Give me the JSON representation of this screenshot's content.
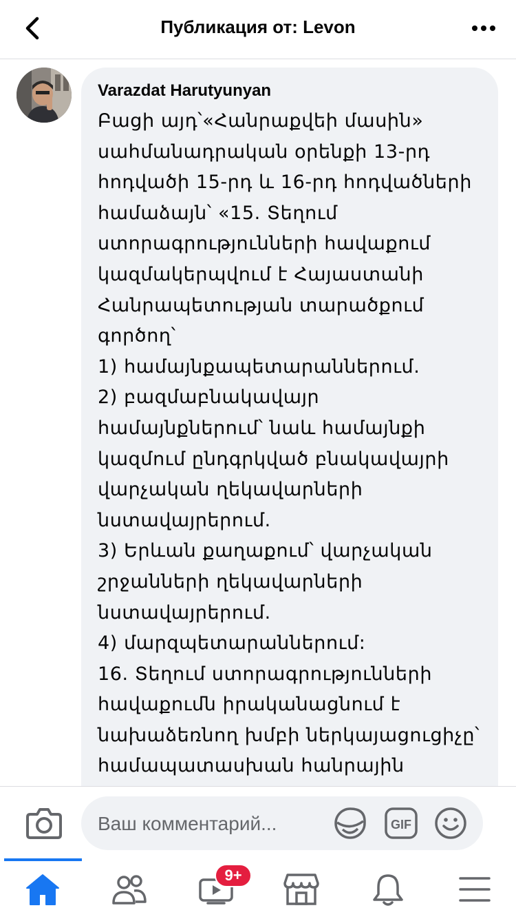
{
  "header": {
    "title": "Публикация от: Levon",
    "back_icon": "chevron-left-icon",
    "more_icon": "more-horizontal-icon"
  },
  "comment": {
    "author": "Varazdat Harutyunyan",
    "text": "Բացի այդ՝«Հանրաքվեի մասին» սահմանադրական օրենքի 13-րդ հոդվածի 15-րդ և 16-րդ հոդվածների համաձայն՝ «15. Տեղում ստորագրությունների հավաքում կազմակերպվում է Հայաստանի Հանրապետության տարածքում գործող՝\n1) համայնքապետարաններում.\n2) բազմաբնակավայր համայնքներում՝ նաև համայնքի կազմում ընդգրկված բնակավայրի վարչական ղեկավարների նստավայրերում.\n3) Երևան քաղաքում՝ վարչական շրջանների ղեկավարների նստավայրերում.\n4) մարզպետարաններում:\n16. Տեղում ստորագրությունների հավաքումն իրականացնում է նախաձեռնող խմբի ներկայացուցիչը՝ համապատասխան հանրային"
  },
  "composer": {
    "placeholder": "Ваш комментарий...",
    "camera_icon": "camera-icon",
    "sticker_icon": "sticker-icon",
    "gif_label": "GIF",
    "emoji_icon": "smiley-icon"
  },
  "bottom_nav": {
    "items": [
      "home-icon",
      "friends-icon",
      "watch-icon",
      "marketplace-icon",
      "notifications-icon",
      "menu-icon"
    ],
    "watch_badge": "9+",
    "active_index": 0,
    "accent_color": "#1877f2",
    "badge_color": "#e41e3f"
  }
}
